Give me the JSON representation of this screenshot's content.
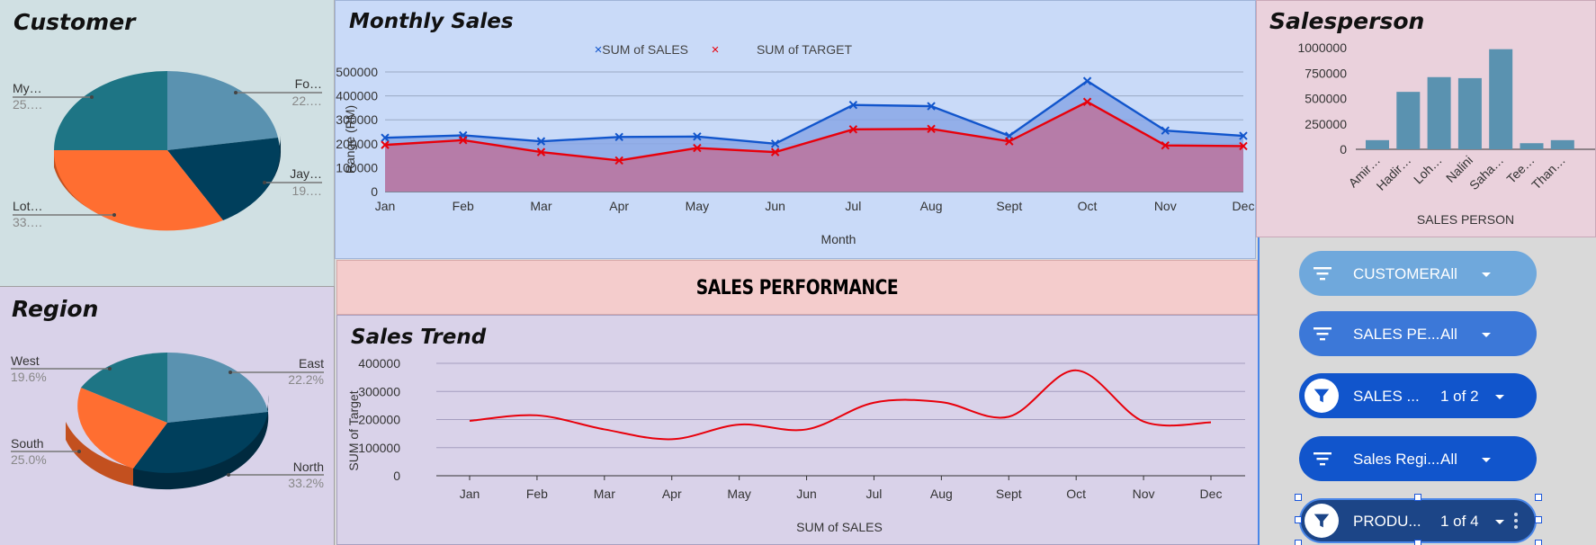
{
  "banner": {
    "title": "SALES PERFORMANCE"
  },
  "customer": {
    "title": "Customer",
    "labels": [
      {
        "name": "My…",
        "pct": "25.…"
      },
      {
        "name": "Fo…",
        "pct": "22.…"
      },
      {
        "name": "Jay…",
        "pct": "19.…"
      },
      {
        "name": "Lot…",
        "pct": "33.…"
      }
    ],
    "colors": [
      "#5a92b0",
      "#003f5c",
      "#ff6e31",
      "#1e7585"
    ]
  },
  "region": {
    "title": "Region",
    "labels": [
      {
        "name": "West",
        "pct": "19.6%"
      },
      {
        "name": "East",
        "pct": "22.2%"
      },
      {
        "name": "South",
        "pct": "25.0%"
      },
      {
        "name": "North",
        "pct": "33.2%"
      }
    ]
  },
  "monthly": {
    "title": "Monthly Sales",
    "legend_sales": "SUM of SALES",
    "legend_target": "SUM of TARGET",
    "ylabel": "Range (RM)",
    "xlabel": "Month",
    "yticks": [
      "500000",
      "400000",
      "300000",
      "200000",
      "100000",
      "0"
    ],
    "months": [
      "Jan",
      "Feb",
      "Mar",
      "Apr",
      "May",
      "Jun",
      "Jul",
      "Aug",
      "Sept",
      "Oct",
      "Nov",
      "Dec"
    ]
  },
  "salesperson": {
    "title": "Salesperson",
    "yticks": [
      "1000000",
      "750000",
      "500000",
      "250000",
      "0"
    ],
    "names": [
      "Amir…",
      "Hadir…",
      "Loh…",
      "Nalini",
      "Saha…",
      "Tee…",
      "Than…"
    ],
    "xlabel": "SALES PERSON"
  },
  "trend": {
    "title": "Sales Trend",
    "yticks": [
      "400000",
      "300000",
      "200000",
      "100000",
      "0"
    ],
    "ylabel": "SUM of Target",
    "xlabel": "SUM of SALES",
    "months": [
      "Jan",
      "Feb",
      "Mar",
      "Apr",
      "May",
      "Jun",
      "Jul",
      "Aug",
      "Sept",
      "Oct",
      "Nov",
      "Dec"
    ]
  },
  "filters": [
    {
      "label": "CUSTOMER",
      "value": "All"
    },
    {
      "label": "SALES PE...",
      "value": "All"
    },
    {
      "label": "SALES ...",
      "value": "1 of 2"
    },
    {
      "label": "Sales Regi...",
      "value": "All"
    },
    {
      "label": "PRODU...",
      "value": "1 of 4"
    }
  ],
  "chart_data": [
    {
      "type": "pie",
      "title": "Customer",
      "labels": [
        "Fo…",
        "Jay…",
        "Lot…",
        "My…"
      ],
      "values": [
        22,
        19,
        33,
        25
      ]
    },
    {
      "type": "pie",
      "title": "Region",
      "labels": [
        "East",
        "North",
        "South",
        "West"
      ],
      "values": [
        22.2,
        33.2,
        25.0,
        19.6
      ]
    },
    {
      "type": "area",
      "title": "Monthly Sales",
      "categories": [
        "Jan",
        "Feb",
        "Mar",
        "Apr",
        "May",
        "Jun",
        "Jul",
        "Aug",
        "Sept",
        "Oct",
        "Nov",
        "Dec"
      ],
      "series": [
        {
          "name": "SUM of SALES",
          "values": [
            225000,
            235000,
            210000,
            228000,
            230000,
            200000,
            362000,
            357000,
            233000,
            462000,
            255000,
            233000
          ],
          "color": "#1155cc"
        },
        {
          "name": "SUM of TARGET",
          "values": [
            195000,
            215000,
            165000,
            130000,
            182000,
            165000,
            260000,
            262000,
            210000,
            375000,
            193000,
            190000
          ],
          "color": "#e8000b"
        }
      ],
      "xlabel": "Month",
      "ylabel": "Range (RM)",
      "ylim": [
        0,
        500000
      ],
      "legend": "top"
    },
    {
      "type": "bar",
      "title": "Salesperson",
      "categories": [
        "Amir…",
        "Hadir…",
        "Loh…",
        "Nalini",
        "Saha…",
        "Tee…",
        "Than…"
      ],
      "values": [
        90000,
        565000,
        710000,
        700000,
        985000,
        60000,
        90000
      ],
      "xlabel": "SALES PERSON",
      "ylim": [
        0,
        1000000
      ],
      "color": "#5a92b0"
    },
    {
      "type": "line",
      "title": "Sales Trend",
      "categories": [
        "Jan",
        "Feb",
        "Mar",
        "Apr",
        "May",
        "Jun",
        "Jul",
        "Aug",
        "Sept",
        "Oct",
        "Nov",
        "Dec"
      ],
      "values": [
        195000,
        215000,
        165000,
        130000,
        182000,
        165000,
        260000,
        262000,
        210000,
        375000,
        193000,
        190000
      ],
      "xlabel": "SUM of SALES",
      "ylabel": "SUM of Target",
      "ylim": [
        0,
        400000
      ],
      "color": "#e8000b"
    }
  ]
}
